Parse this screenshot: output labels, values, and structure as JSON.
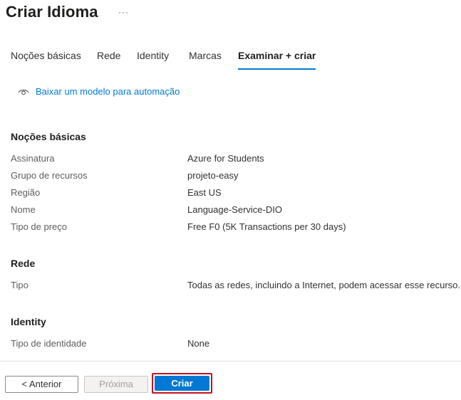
{
  "header": {
    "title": "Criar Idioma",
    "more_label": "···"
  },
  "tabs": [
    {
      "label": "Noções básicas",
      "active": false
    },
    {
      "label": "Rede",
      "active": false
    },
    {
      "label": "Identity",
      "active": false
    },
    {
      "label": "Marcas",
      "active": false
    },
    {
      "label": "Examinar + criar",
      "active": true
    }
  ],
  "download_link": {
    "icon": "eye-icon",
    "label": "Baixar um modelo para automação"
  },
  "sections": {
    "basics": {
      "title": "Noções básicas",
      "rows": [
        {
          "label": "Assinatura",
          "value": "Azure for Students"
        },
        {
          "label": "Grupo de recursos",
          "value": "projeto-easy"
        },
        {
          "label": "Região",
          "value": "East US"
        },
        {
          "label": "Nome",
          "value": "Language-Service-DIO"
        },
        {
          "label": "Tipo de preço",
          "value": "Free F0 (5K Transactions per 30 days)"
        }
      ]
    },
    "network": {
      "title": "Rede",
      "rows": [
        {
          "label": "Tipo",
          "value": "Todas as redes, incluindo a Internet, podem acessar esse recurso."
        }
      ]
    },
    "identity": {
      "title": "Identity",
      "rows": [
        {
          "label": "Tipo de identidade",
          "value": "None"
        }
      ]
    }
  },
  "footer": {
    "previous_label": "< Anterior",
    "next_label": "Próxima",
    "create_label": "Criar"
  },
  "colors": {
    "accent": "#0078d4",
    "highlight_border": "#c50f1f"
  }
}
